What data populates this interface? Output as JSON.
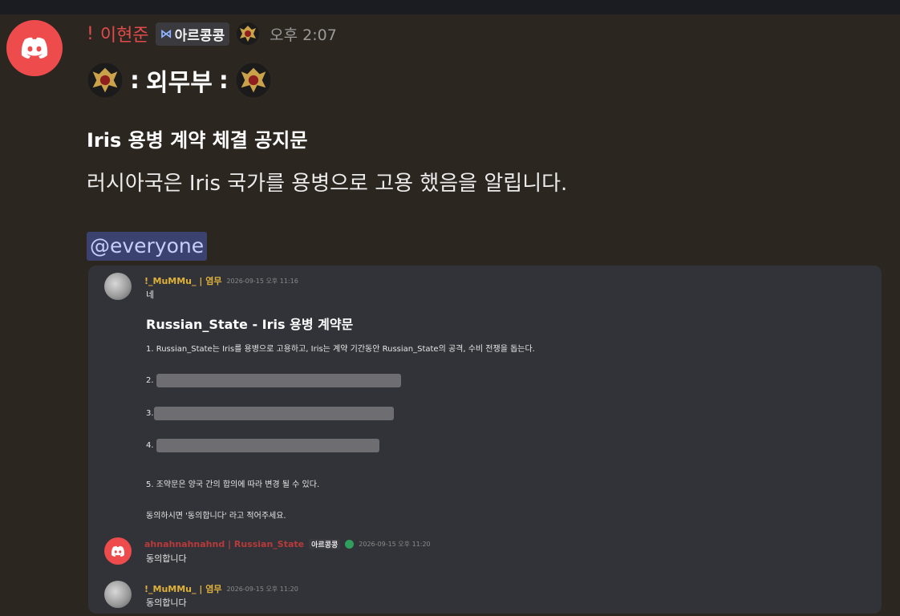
{
  "header": {
    "prefix": "!",
    "username": "이현준",
    "tag_label": "아르콩콩",
    "tag_icon": "butterfly-icon",
    "timestamp": "오후 2:07"
  },
  "channel": {
    "separator_left": ":",
    "name": "외무부",
    "separator_right": ":"
  },
  "message": {
    "title": "Iris 용병 계약 체결 공지문",
    "body": "러시아국은 Iris 국가를 용병으로 고용 했음을 알립니다.",
    "mention": "@everyone"
  },
  "embed": {
    "msg1": {
      "author": "!_MuMMu_ | 염무",
      "timestamp": "2026-09-15 오후 11:16",
      "reply": "네"
    },
    "contract_title": "Russian_State - Iris 용병 계약문",
    "clause1": "1. Russian_State는 Iris를 용병으로 고용하고, Iris는 계약 기간동안 Russian_State의 공격, 수비 전쟁을 돕는다.",
    "clause2_num": "2.",
    "clause3_num": "3.",
    "clause4_num": "4.",
    "clause5": "5. 조약문은 양국 간의 합의에 따라 변경 될 수 있다.",
    "consent_prompt": "동의하시면 '동의합니다' 라고 적어주세요.",
    "msg2": {
      "author": "ahnahnahnahnd | Russian_State",
      "tag": "아르콩콩",
      "timestamp": "2026-09-15 오후 11:20",
      "reply": "동의합니다"
    },
    "msg3": {
      "author": "!_MuMMu_ | 염무",
      "timestamp": "2026-09-15 오후 11:20",
      "reply": "동의합니다"
    }
  },
  "colors": {
    "background": "#2c2620",
    "discord_red": "#ee4b4c",
    "username_red": "#e14b4b",
    "mention_bg": "#3c4270",
    "embed_bg": "#313338",
    "gold_name": "#e0b23c"
  }
}
